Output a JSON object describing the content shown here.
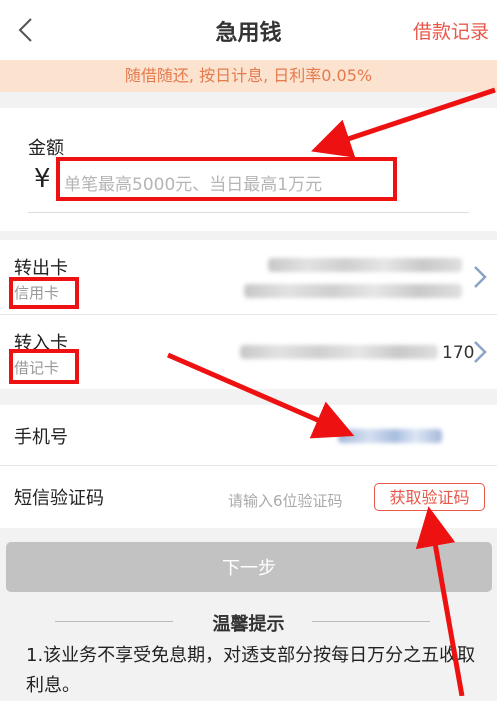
{
  "header": {
    "title": "急用钱",
    "right_link": "借款记录",
    "back_icon": "chevron-left-icon"
  },
  "notice": "随借随还, 按日计息, 日利率0.05%",
  "amount": {
    "label": "金额",
    "currency_symbol": "¥",
    "placeholder": "单笔最高5000元、当日最高1万元",
    "value": ""
  },
  "transfer_out": {
    "label": "转出卡",
    "card_type": "信用卡"
  },
  "transfer_in": {
    "label": "转入卡",
    "card_type": "借记卡",
    "card_tail": "170"
  },
  "phone": {
    "label": "手机号"
  },
  "sms": {
    "label": "短信验证码",
    "placeholder": "请输入6位验证码",
    "button": "获取验证码"
  },
  "next_button": "下一步",
  "tips": {
    "title": "温馨提示",
    "text": "1.该业务不享受免息期，对透支部分按每日万分之五收取利息。"
  },
  "colors": {
    "accent": "#e9584b",
    "notice_bg": "#fbe3cf",
    "annotation_red": "#ee1111",
    "disabled_button": "#c2c2c2"
  }
}
